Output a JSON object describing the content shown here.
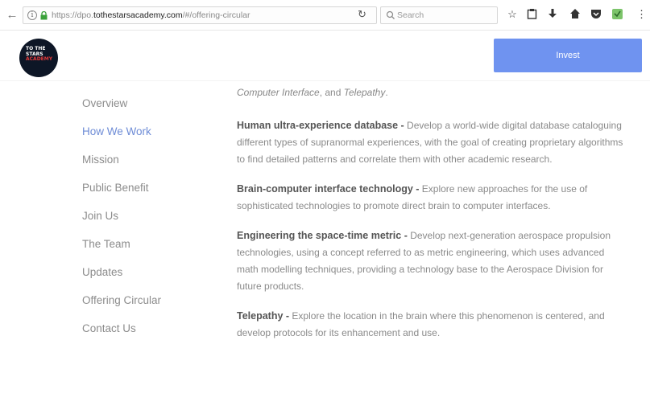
{
  "browser": {
    "url_prefix": "https://dpo.",
    "url_domain": "tothestarsacademy.com",
    "url_path": "/#/offering-circular",
    "search_placeholder": "Search"
  },
  "header": {
    "logo_line1": "TO THE",
    "logo_line2": "STARS",
    "logo_line3": "ACADEMY",
    "invest_label": "Invest"
  },
  "sidebar": {
    "items": [
      {
        "label": "Overview",
        "active": false
      },
      {
        "label": "How We Work",
        "active": true
      },
      {
        "label": "Mission",
        "active": false
      },
      {
        "label": "Public Benefit",
        "active": false
      },
      {
        "label": "Join Us",
        "active": false
      },
      {
        "label": "The Team",
        "active": false
      },
      {
        "label": "Updates",
        "active": false
      },
      {
        "label": "Offering Circular",
        "active": false
      },
      {
        "label": "Contact Us",
        "active": false
      }
    ]
  },
  "content": {
    "intro_italic1": "Computer Interface",
    "intro_mid": ", and ",
    "intro_italic2": "Telepathy",
    "intro_end": ".",
    "sections": [
      {
        "title": "Human ultra-experience database -",
        "body": " Develop a world-wide digital database cataloguing different types of supranormal experiences, with the goal of creating proprietary algorithms to find detailed patterns and correlate them with other academic research."
      },
      {
        "title": "Brain-computer interface technology -",
        "body": " Explore new approaches for the use of sophisticated technologies to promote direct brain to computer interfaces."
      },
      {
        "title": "Engineering the space-time metric -",
        "body": " Develop next-generation aerospace propulsion technologies, using a concept referred to as metric engineering, which uses advanced math modelling techniques, providing a technology base to the Aerospace Division for future products."
      },
      {
        "title": "Telepathy -",
        "body": " Explore the location in the brain where this phenomenon is centered, and develop protocols for its enhancement and use."
      }
    ]
  }
}
